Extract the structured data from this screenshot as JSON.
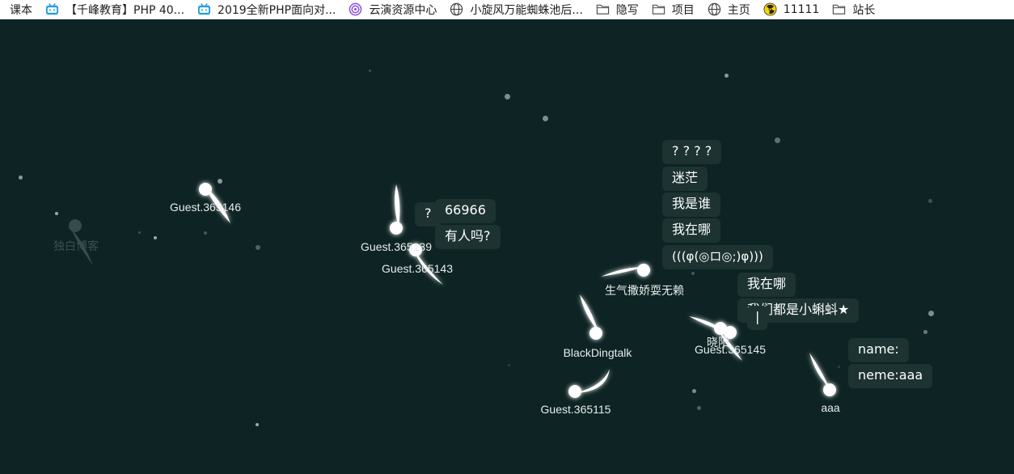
{
  "bookmarks": [
    {
      "label": "课本",
      "icon": "book-icon"
    },
    {
      "label": "【千峰教育】PHP 40...",
      "icon": "bilibili-icon"
    },
    {
      "label": "2019全新PHP面向对...",
      "icon": "bilibili-icon"
    },
    {
      "label": "云演资源中心",
      "icon": "spiral-icon"
    },
    {
      "label": "小旋风万能蜘蛛池后...",
      "icon": "globe-icon"
    },
    {
      "label": "隐写",
      "icon": "folder-icon"
    },
    {
      "label": "项目",
      "icon": "folder-icon"
    },
    {
      "label": "主页",
      "icon": "globe-icon"
    },
    {
      "label": "11111",
      "icon": "radiation-icon"
    },
    {
      "label": "站长",
      "icon": "folder-icon"
    }
  ],
  "players": [
    {
      "name": "独白博客",
      "ghost": true
    },
    {
      "name": "Guest.365146"
    },
    {
      "name": "Guest.365139"
    },
    {
      "name": "Guest.365143"
    },
    {
      "name": "生气撒娇耍无赖"
    },
    {
      "name": "BlackDingtalk"
    },
    {
      "name": "Guest.365115"
    },
    {
      "name": "晓阳"
    },
    {
      "name": "Guest.365145"
    },
    {
      "name": "aaa"
    }
  ],
  "bubbles": [
    {
      "text": "?"
    },
    {
      "text": "66966"
    },
    {
      "text": "有人吗?"
    },
    {
      "text": "? ? ? ?"
    },
    {
      "text": "迷茫"
    },
    {
      "text": "我是谁"
    },
    {
      "text": "我在哪"
    },
    {
      "text": "(((φ(◎ロ◎;)φ)))"
    },
    {
      "text": "我在哪"
    },
    {
      "text": "我们都是小蝌蚪★"
    },
    {
      "text": "|"
    },
    {
      "text": "name:"
    },
    {
      "text": "neme:aaa"
    }
  ],
  "colors": {
    "background": "#0e2424",
    "bubble": "#1c3332",
    "tadpole": "#ffffff"
  }
}
